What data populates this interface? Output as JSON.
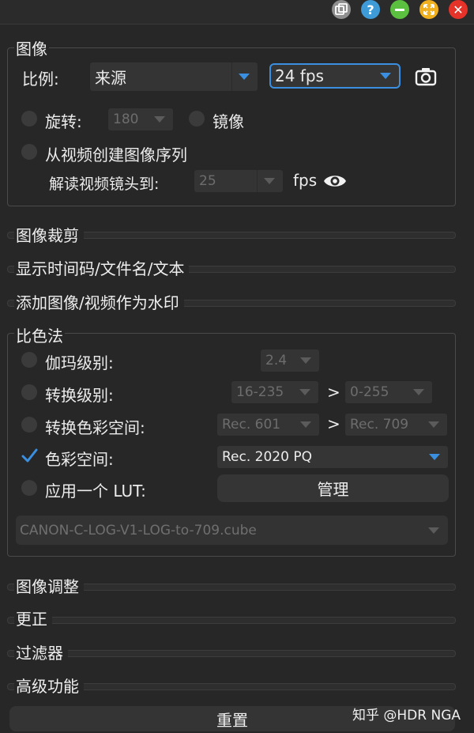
{
  "image_group": {
    "title": "图像",
    "ratio_label": "比例:",
    "source_value": "来源",
    "fps_value": "24 fps",
    "rotate_label": "旋转:",
    "rotate_value": "180",
    "mirror_label": "镜像",
    "sequence_label": "从视频创建图像序列",
    "decode_label": "解读视频镜头到:",
    "decode_value": "25",
    "fps_unit": "fps"
  },
  "sections_top": [
    {
      "label": "图像裁剪"
    },
    {
      "label": "显示时间码/文件名/文本"
    },
    {
      "label": "添加图像/视频作为水印"
    }
  ],
  "color_group": {
    "title": "比色法",
    "gamma_label": "伽玛级别:",
    "gamma_value": "2.4",
    "level_label": "转换级别:",
    "level_from": "16-235",
    "level_to": "0-255",
    "space_conv_label": "转换色彩空间:",
    "space_from": "Rec. 601",
    "space_to": "Rec. 709",
    "arrow_symbol": ">",
    "color_space_label": "色彩空间:",
    "color_space_value": "Rec. 2020 PQ",
    "lut_label": "应用一个 LUT:",
    "manage_label": "管理",
    "lut_file": "CANON-C-LOG-V1-LOG-to-709.cube"
  },
  "sections_bottom": [
    {
      "label": "图像调整"
    },
    {
      "label": "更正"
    },
    {
      "label": "过滤器"
    },
    {
      "label": "高级功能"
    }
  ],
  "reset_label": "重置",
  "watermark": "知乎 @HDR NGA",
  "colors": {
    "accent": "#3a8fe0",
    "help": "#3f9bd7",
    "minimize": "#5bbf3f",
    "expand": "#f0b020",
    "close": "#e5332a"
  }
}
